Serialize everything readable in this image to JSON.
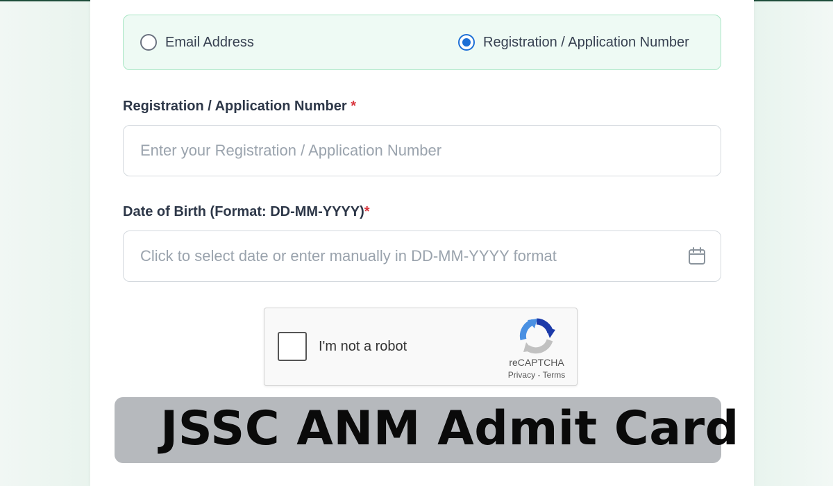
{
  "login_method": {
    "options": [
      {
        "label": "Email Address",
        "selected": false
      },
      {
        "label": "Registration / Application Number",
        "selected": true
      }
    ]
  },
  "registration_field": {
    "label": "Registration / Application Number",
    "required_marker": "*",
    "placeholder": "Enter your Registration / Application Number",
    "value": ""
  },
  "dob_field": {
    "label": "Date of Birth (Format: DD-MM-YYYY)",
    "required_marker": "*",
    "placeholder": "Click to select date or enter manually in DD-MM-YYYY format",
    "value": "",
    "icon": "calendar-icon"
  },
  "captcha": {
    "checkbox_label": "I'm not a robot",
    "brand": "reCAPTCHA",
    "privacy": "Privacy",
    "separator": " - ",
    "terms": "Terms",
    "icon": "recaptcha-logo-icon"
  },
  "banner": {
    "title": "JSSC ANM Admit Card"
  },
  "colors": {
    "accent": "#1d6fd6",
    "panel_bg": "#eefaf4",
    "panel_border": "#a8e6c4",
    "required": "#d9363e",
    "banner_bg": "#b6b9bd"
  }
}
